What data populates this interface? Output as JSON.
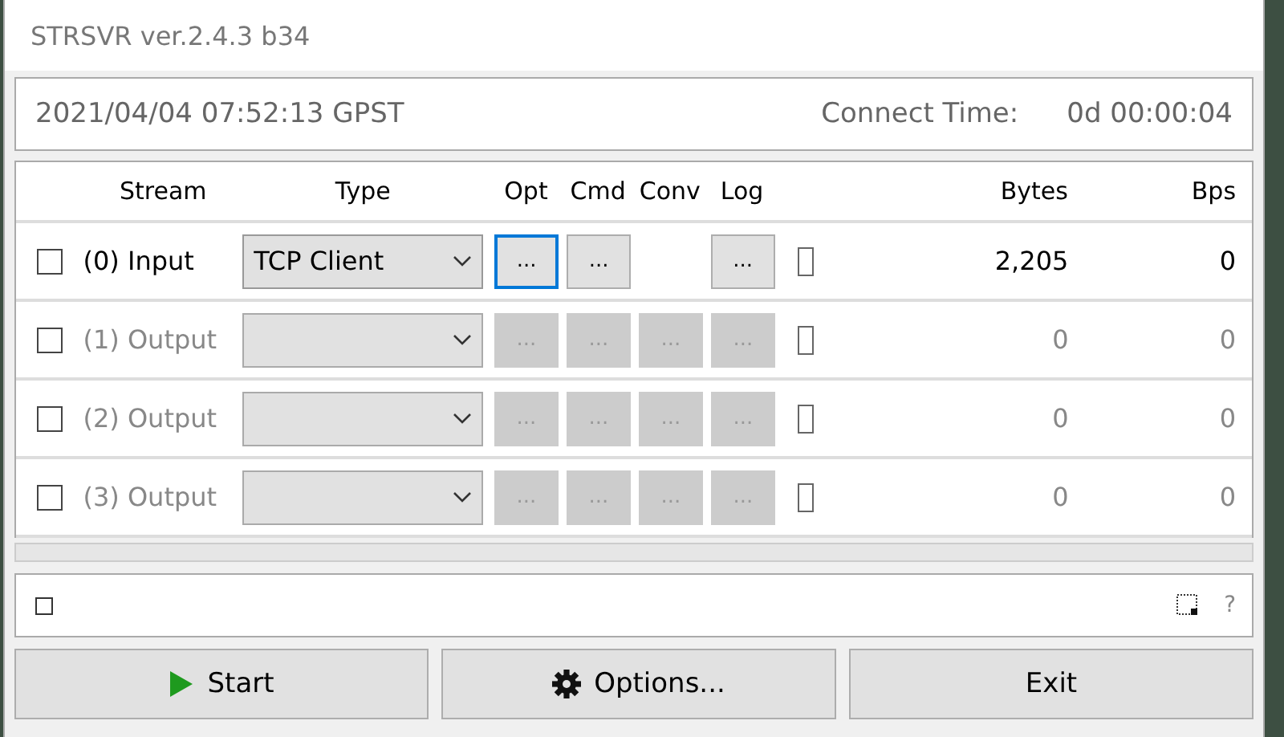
{
  "window": {
    "title": "STRSVR ver.2.4.3 b34"
  },
  "status": {
    "time": "2021/04/04 07:52:13 GPST",
    "connect_label": "Connect Time:",
    "connect_value": "0d 00:00:04"
  },
  "table": {
    "columns": [
      "Stream",
      "Type",
      "Opt",
      "Cmd",
      "Conv",
      "Log",
      "Bytes",
      "Bps"
    ],
    "rows": [
      {
        "checked": false,
        "disabled": false,
        "stream": "(0) Input",
        "type": "TCP Client",
        "opt": {
          "label": "...",
          "focused": true
        },
        "cmd": {
          "label": "...",
          "focused": false
        },
        "log": {
          "label": "...",
          "focused": false
        },
        "log_checked": false,
        "bytes": "2,205",
        "bps": "0"
      },
      {
        "checked": false,
        "disabled": true,
        "stream": "(1) Output",
        "opt": {
          "label": "...",
          "focused": false
        },
        "cmd": {
          "label": "...",
          "focused": false
        },
        "conv": {
          "label": "...",
          "focused": false
        },
        "log": {
          "label": "...",
          "focused": false
        },
        "log_checked": false,
        "bytes": "0",
        "bps": "0"
      },
      {
        "checked": false,
        "disabled": true,
        "stream": "(2) Output",
        "opt": {
          "label": "...",
          "focused": false
        },
        "cmd": {
          "label": "...",
          "focused": false
        },
        "conv": {
          "label": "...",
          "focused": false
        },
        "log": {
          "label": "...",
          "focused": false
        },
        "log_checked": false,
        "bytes": "0",
        "bps": "0"
      },
      {
        "checked": false,
        "disabled": true,
        "stream": "(3) Output",
        "opt": {
          "label": "...",
          "focused": false
        },
        "cmd": {
          "label": "...",
          "focused": false
        },
        "conv": {
          "label": "...",
          "focused": false
        },
        "log": {
          "label": "...",
          "focused": false
        },
        "log_checked": false,
        "bytes": "0",
        "bps": "0"
      }
    ]
  },
  "panel": {
    "checked": false,
    "help": "?"
  },
  "buttons": [
    {
      "kind": "start",
      "label": "Start"
    },
    {
      "kind": "options",
      "label": "Options..."
    },
    {
      "kind": "exit",
      "label": "Exit"
    }
  ]
}
